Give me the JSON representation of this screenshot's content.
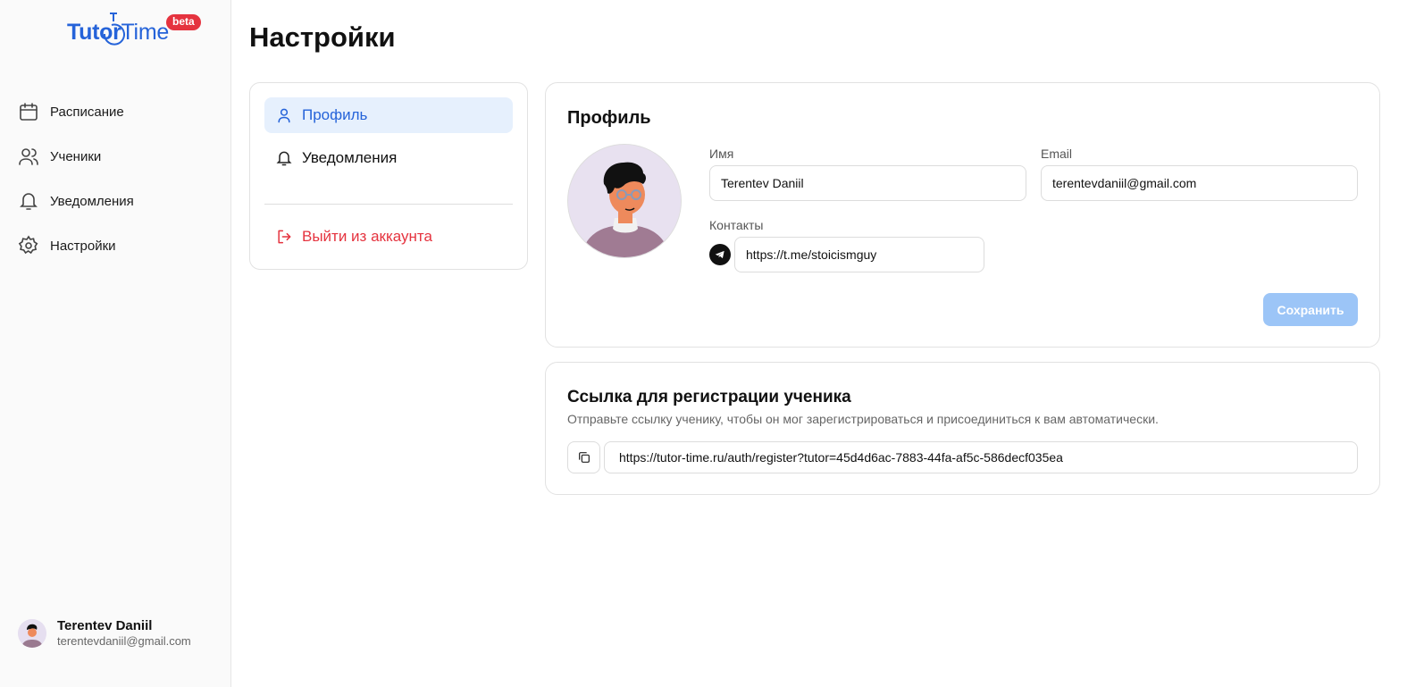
{
  "brand": {
    "name_part1": "Tutor",
    "name_part2": "Time",
    "badge": "beta",
    "color": "#2563d9",
    "badge_color": "#e5333f"
  },
  "sidebar": {
    "items": [
      {
        "label": "Расписание",
        "icon": "calendar-icon"
      },
      {
        "label": "Ученики",
        "icon": "users-icon"
      },
      {
        "label": "Уведомления",
        "icon": "bell-icon"
      },
      {
        "label": "Настройки",
        "icon": "gear-icon"
      }
    ],
    "user": {
      "name": "Terentev Daniil",
      "email": "terentevdaniil@gmail.com"
    }
  },
  "page": {
    "title": "Настройки"
  },
  "settings_menu": {
    "items": [
      {
        "label": "Профиль",
        "icon": "user-icon",
        "active": true
      },
      {
        "label": "Уведомления",
        "icon": "bell-icon",
        "active": false
      }
    ],
    "logout_label": "Выйти из аккаунта"
  },
  "profile": {
    "title": "Профиль",
    "name_label": "Имя",
    "name_value": "Terentev Daniil",
    "email_label": "Email",
    "email_value": "terentevdaniil@gmail.com",
    "contacts_label": "Контакты",
    "telegram_value": "https://t.me/stoicismguy",
    "save_label": "Сохранить"
  },
  "registration_link": {
    "title": "Ссылка для регистрации ученика",
    "description": "Отправьте ссылку ученику, чтобы он мог зарегистрироваться и присоединиться к вам автоматически.",
    "url": "https://tutor-time.ru/auth/register?tutor=45d4d6ac-7883-44fa-af5c-586decf035ea"
  },
  "colors": {
    "accent": "#2563d9",
    "danger": "#e5333f",
    "active_bg": "#e6f0fd",
    "save_disabled": "#9cc5f7"
  }
}
